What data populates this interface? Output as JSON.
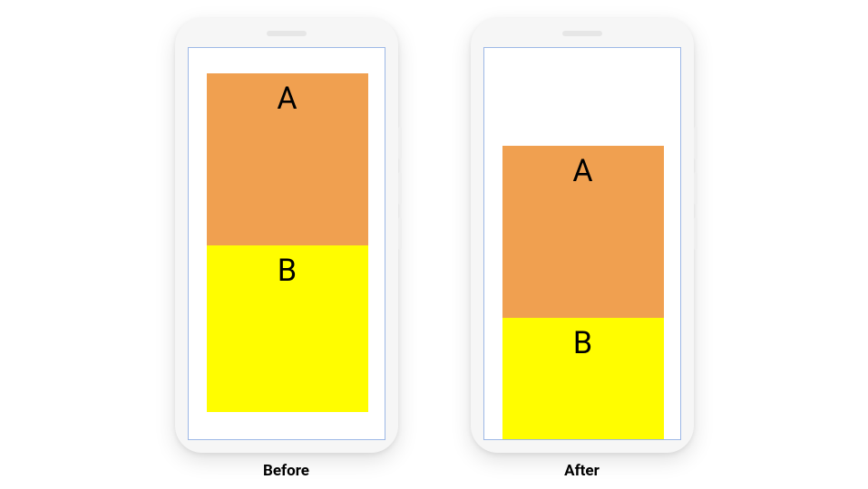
{
  "phones": {
    "before": {
      "caption": "Before",
      "boxA": "A",
      "boxB": "B"
    },
    "after": {
      "caption": "After",
      "boxA": "A",
      "boxB": "B"
    }
  },
  "colors": {
    "boxA": "#f0a050",
    "boxB": "#fffd00",
    "screenBorder": "#9db8e6",
    "phoneBody": "#f6f6f6"
  }
}
